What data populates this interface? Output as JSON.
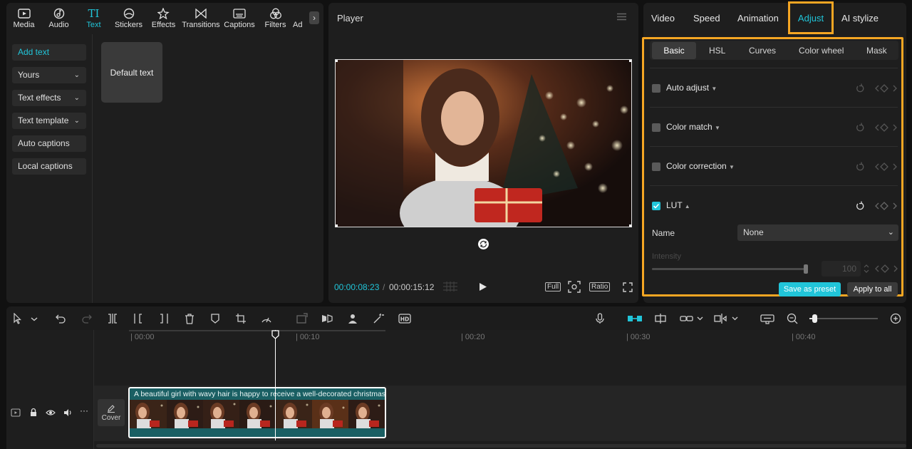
{
  "tool_tabs": [
    {
      "label": "Media",
      "icon": "media-icon"
    },
    {
      "label": "Audio",
      "icon": "audio-icon"
    },
    {
      "label": "Text",
      "icon": "text-icon",
      "active": true
    },
    {
      "label": "Stickers",
      "icon": "stickers-icon"
    },
    {
      "label": "Effects",
      "icon": "effects-icon"
    },
    {
      "label": "Transitions",
      "icon": "transitions-icon"
    },
    {
      "label": "Captions",
      "icon": "captions-icon"
    },
    {
      "label": "Filters",
      "icon": "filters-icon"
    },
    {
      "label": "Ad",
      "icon": "adjustment-icon"
    }
  ],
  "text_menu": {
    "add_text": "Add text",
    "yours": "Yours",
    "text_effects": "Text effects",
    "text_template": "Text template",
    "auto_captions": "Auto captions",
    "local_captions": "Local captions"
  },
  "default_text_card": "Default text",
  "player": {
    "title": "Player",
    "current_time": "00:00:08:23",
    "separator": "/",
    "total_time": "00:00:15:12",
    "full_label": "Full",
    "ratio_label": "Ratio"
  },
  "right_tabs": {
    "video": "Video",
    "speed": "Speed",
    "animation": "Animation",
    "adjust": "Adjust",
    "ai_stylize": "AI stylize"
  },
  "adjust_subtabs": {
    "basic": "Basic",
    "hsl": "HSL",
    "curves": "Curves",
    "color_wheel": "Color wheel",
    "mask": "Mask"
  },
  "adjust_rows": {
    "auto_adjust": "Auto adjust",
    "color_match": "Color match",
    "color_correction": "Color correction",
    "lut": "LUT"
  },
  "lut": {
    "name_label": "Name",
    "name_value": "None",
    "intensity_label": "Intensity",
    "intensity_value": "100",
    "intensity_level": 1.0
  },
  "buttons": {
    "save_as_preset": "Save as preset",
    "apply_to_all": "Apply to all"
  },
  "timeline": {
    "ticks": [
      "| 00:00",
      "| 00:10",
      "| 00:20",
      "| 00:30",
      "| 00:40"
    ],
    "clip_caption": "A beautiful girl with wavy hair is happy to receive a well-decorated christmas",
    "cover_label": "Cover"
  },
  "colors": {
    "accent": "#21c5d9",
    "highlight_box": "#f5a623",
    "clip_bg": "#1a5f63"
  }
}
